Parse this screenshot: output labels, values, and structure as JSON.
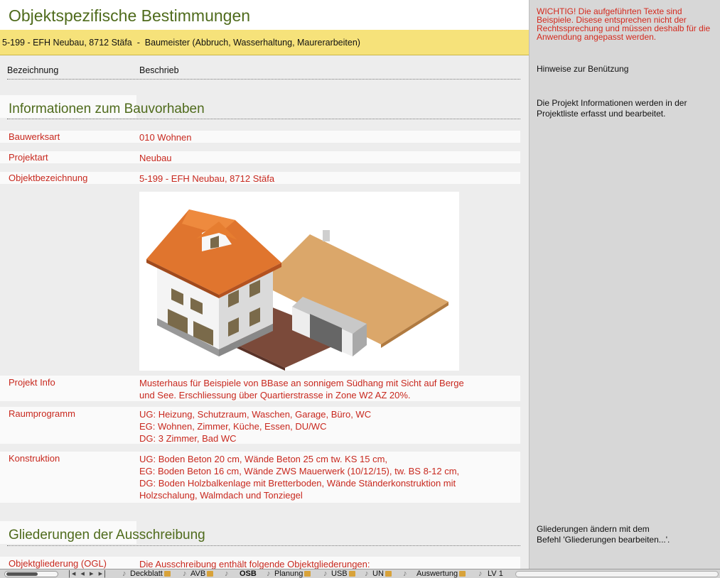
{
  "header": {
    "title": "Objektspezifische Bestimmungen",
    "project_line": "5-199 - EFH Neubau, 8712 Stäfa  -  Baumeister (Abbruch, Wasserhaltung, Maurerarbeiten)"
  },
  "columns": {
    "label": "Bezeichnung",
    "description": "Beschrieb"
  },
  "section1": {
    "title": "Informationen zum Bauvorhaben",
    "rows": [
      {
        "label": "Bauwerksart",
        "value": "010 Wohnen"
      },
      {
        "label": "Projektart",
        "value": "Neubau"
      },
      {
        "label": "Objektbezeichnung",
        "value": "5-199 - EFH Neubau, 8712 Stäfa"
      }
    ],
    "info": {
      "label": "Projekt Info",
      "lines": [
        "Musterhaus für Beispiele von BBase an sonnigem Südhang mit Sicht auf Berge",
        "und See. Erschliessung über Quartierstrasse in Zone W2 AZ 20%."
      ]
    },
    "raum": {
      "label": "Raumprogramm",
      "lines": [
        "UG: Heizung, Schutzraum, Waschen, Garage, Büro, WC",
        "EG: Wohnen, Zimmer, Küche, Essen, DU/WC",
        "DG: 3 Zimmer, Bad WC"
      ]
    },
    "konstruktion": {
      "label": "Konstruktion",
      "lines": [
        "UG: Boden Beton 20 cm, Wände Beton 25 cm tw. KS 15 cm,",
        "EG: Boden Beton 16 cm, Wände ZWS Mauerwerk (10/12/15), tw. BS 8-12 cm,",
        "DG: Boden Holzbalkenlage mit Bretterboden, Wände Ständerkonstruktion mit",
        "Holzschalung, Walmdach und Tonziegel"
      ]
    }
  },
  "section2": {
    "title": "Gliederungen der Ausschreibung",
    "row": {
      "label": "Objektgliederung (OGL)",
      "value": "Die Ausschreibung enthält folgende Objektgliederungen:"
    }
  },
  "sidebar": {
    "warning": "WICHTIG! Die aufgeführten Texte sind Beispiele. Disese entsprechen nicht der Rechtssprechung und  müssen deshalb für die Anwendung  angepasst werden.",
    "usage": "Hinweise zur Benützung",
    "project_note": "Die Projekt Informationen werden in der Projektliste erfasst und bearbeitet.",
    "gliederung_note_1": "Gliederungen ändern mit dem",
    "gliederung_note_2": "Befehl 'Gliederungen bearbeiten...'."
  },
  "tabs": {
    "nav": "|◂ ◂ ▸ ▸|",
    "items": [
      "Deckblatt",
      "AVB",
      "OSB",
      "Planung",
      "USB",
      "UN",
      "Auswertung",
      "LV 1"
    ]
  },
  "colors": {
    "title_green": "#4f6b1c",
    "text_red": "#c8281e",
    "highlight_yellow": "#f6e27a"
  }
}
